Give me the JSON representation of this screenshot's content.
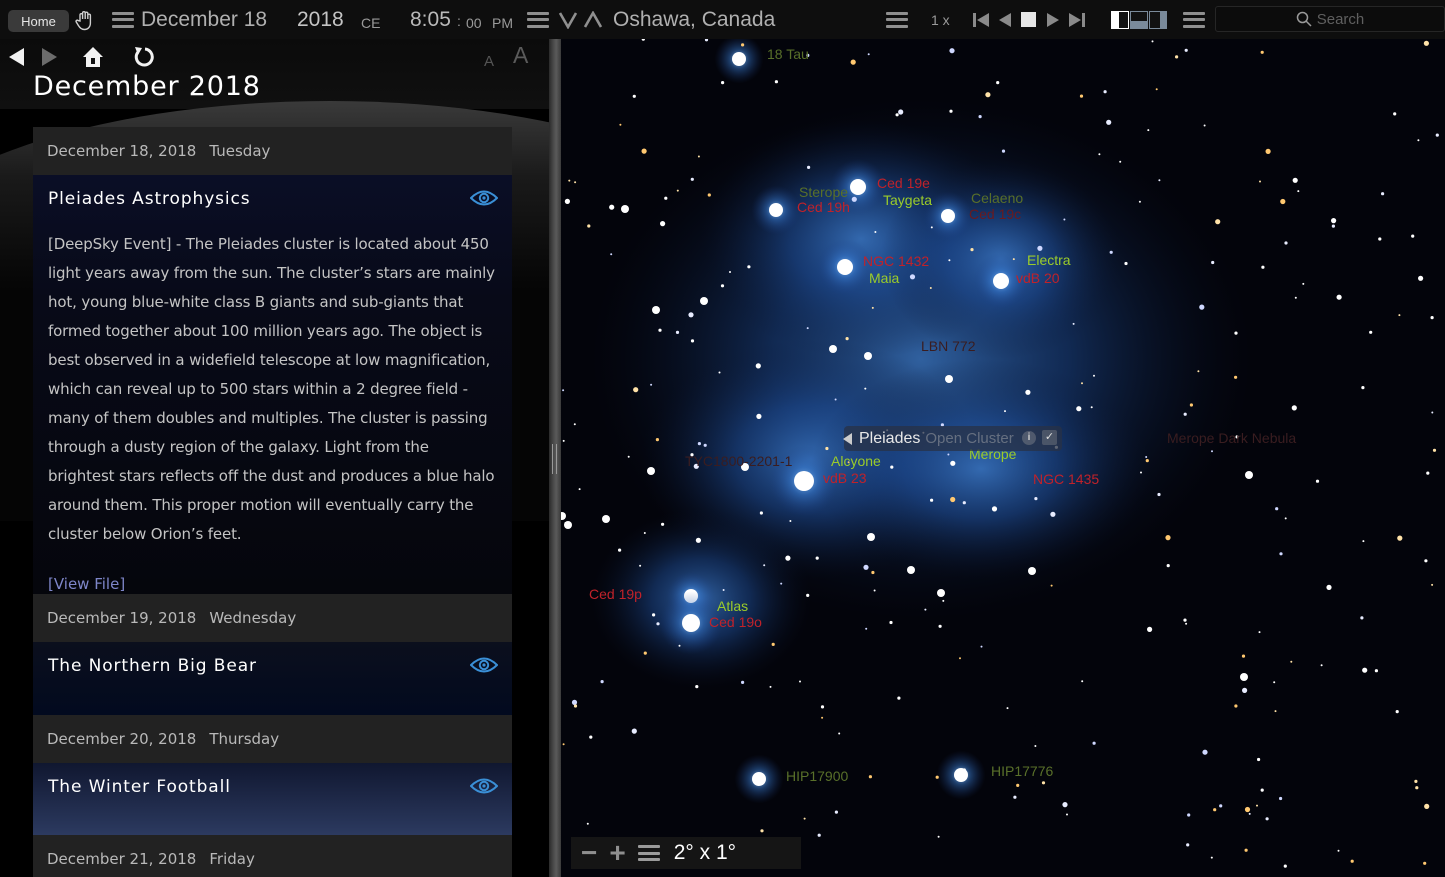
{
  "topbar": {
    "home_label": "Home",
    "date": "December 18",
    "year": "2018",
    "era": "CE",
    "time_hm": "8:05",
    "time_sep": ":",
    "time_s": "00",
    "ampm": "PM",
    "location": "Oshawa, Canada",
    "time_rate": "1 x",
    "search_placeholder": "Search",
    "icons": [
      "hand-icon",
      "menu-icon",
      "chevron-down-icon",
      "chevron-up-icon",
      "skip-back-icon",
      "step-back-icon",
      "stop-icon",
      "play-icon",
      "skip-forward-icon",
      "layout-left-icon",
      "layout-bottom-icon",
      "layout-right-icon",
      "search-icon"
    ]
  },
  "left_panel": {
    "title": "December 2018",
    "font_small_label": "A",
    "font_large_label": "A",
    "days": [
      {
        "date": "December 18, 2018",
        "weekday": "Tuesday",
        "event_title": "Pleiades Astrophysics",
        "description": "[DeepSky Event] - The Pleiades cluster is located about 450 light years away from the sun. The cluster’s stars are mainly hot, young blue-white class B giants and sub-giants that formed together about 100 million years ago. The object is best observed in a widefield telescope at low magnification, which can reveal up to 500 stars within a 2 degree field - many of them doubles and multiples. The cluster is passing through a dusty region of the galaxy. Light from the brightest stars reflects off the dust and produces a blue halo around them. This proper motion will eventually carry the cluster below Orion’s feet.",
        "link": "[View File]"
      },
      {
        "date": "December 19, 2018",
        "weekday": "Wednesday",
        "event_title": "The Northern Big Bear"
      },
      {
        "date": "December 20, 2018",
        "weekday": "Thursday",
        "event_title": "The Winter Football"
      },
      {
        "date": "December 21, 2018",
        "weekday": "Friday"
      }
    ]
  },
  "sky": {
    "selected": {
      "name": "Pleiades",
      "type": "Open Cluster",
      "info_label": "i",
      "check_label": "✓"
    },
    "field_of_view": "2° x 1°",
    "labels": [
      {
        "text": "18 Tau",
        "style": "dimgreen"
      },
      {
        "text": "Ced 19e",
        "style": "red"
      },
      {
        "text": "Sterope",
        "style": "dimgreen"
      },
      {
        "text": "Ced 19h",
        "style": "red"
      },
      {
        "text": "Taygeta",
        "style": "green"
      },
      {
        "text": "Celaeno",
        "style": "dimgreen"
      },
      {
        "text": "Ced 19c",
        "style": "dimred"
      },
      {
        "text": "NGC 1432",
        "style": "red"
      },
      {
        "text": "Maia",
        "style": "green"
      },
      {
        "text": "Electra",
        "style": "green"
      },
      {
        "text": "vdB 20",
        "style": "red"
      },
      {
        "text": "LBN 772",
        "style": "dark"
      },
      {
        "text": "TYC1800-2201-1",
        "style": "dark"
      },
      {
        "text": "Alcyone",
        "style": "green"
      },
      {
        "text": "vdB 23",
        "style": "red"
      },
      {
        "text": "Merope",
        "style": "green"
      },
      {
        "text": "NGC 1435",
        "style": "red"
      },
      {
        "text": "Merope Dark Nebula",
        "style": "dark"
      },
      {
        "text": "Ced 19p",
        "style": "red"
      },
      {
        "text": "Atlas",
        "style": "green"
      },
      {
        "text": "Ced 19o",
        "style": "red"
      },
      {
        "text": "HIP17900",
        "style": "dimgreen"
      },
      {
        "text": "HIP17776",
        "style": "dimgreen"
      }
    ]
  }
}
